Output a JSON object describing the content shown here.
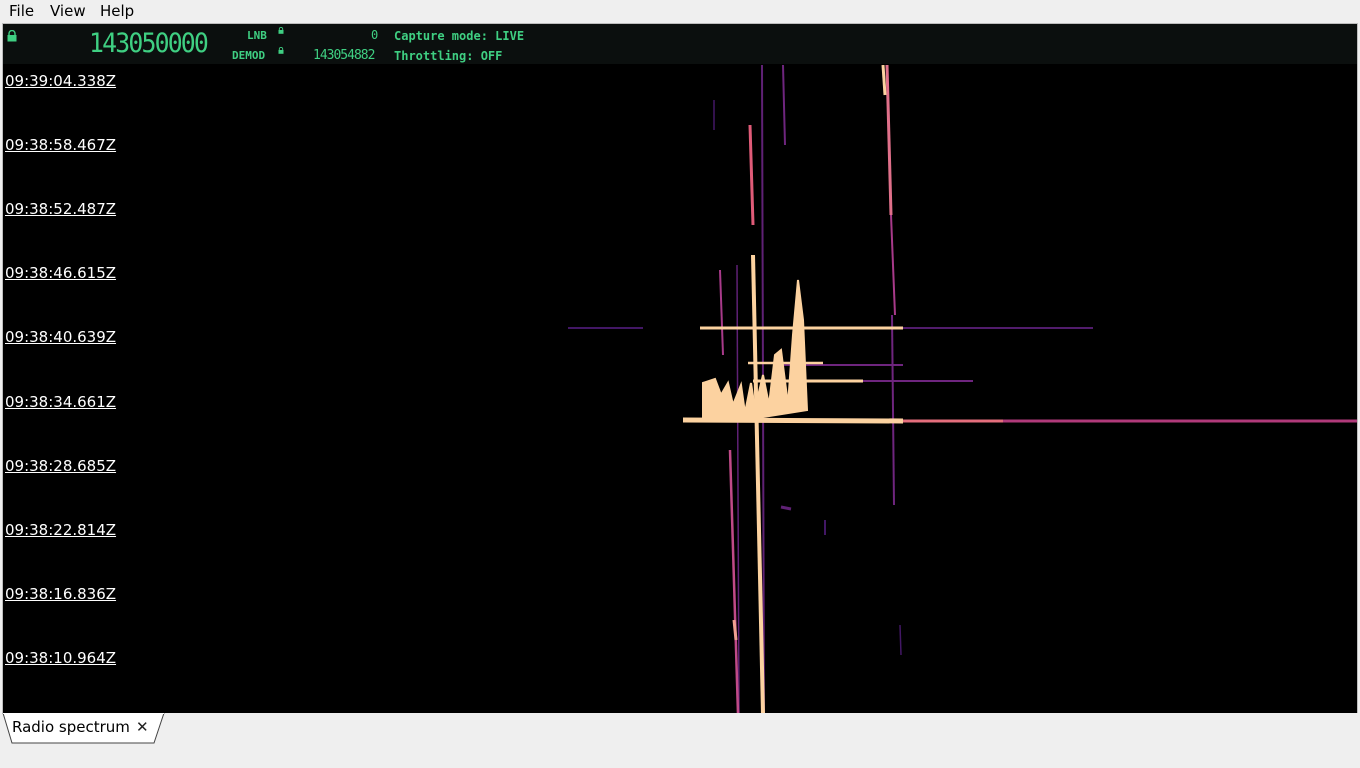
{
  "menubar": {
    "file_label": "File",
    "view_label": "View",
    "help_label": "Help"
  },
  "top_panel": {
    "main_frequency": "143050000",
    "lnb_label": "LNB",
    "lnb_value": "0",
    "demod_label": "DEMOD",
    "demod_frequency": "143054882",
    "capture_mode": "Capture mode: LIVE",
    "throttling": "Throttling: OFF",
    "text_color": "#3fcf82",
    "icons": [
      "lock-icon"
    ]
  },
  "waterfall": {
    "timestamps": [
      "09:39:04.338Z",
      "09:38:58.467Z",
      "09:38:52.487Z",
      "09:38:46.615Z",
      "09:38:40.639Z",
      "09:38:34.661Z",
      "09:38:28.685Z",
      "09:38:22.814Z",
      "09:38:16.836Z",
      "09:38:10.964Z"
    ],
    "colors": {
      "background": "#000000",
      "hot": "#fcd2a0",
      "mid": "#e05b78",
      "low": "#7a2a8c"
    }
  },
  "tabs": [
    {
      "label": "Radio spectrum",
      "close_icon": "close-icon"
    }
  ]
}
